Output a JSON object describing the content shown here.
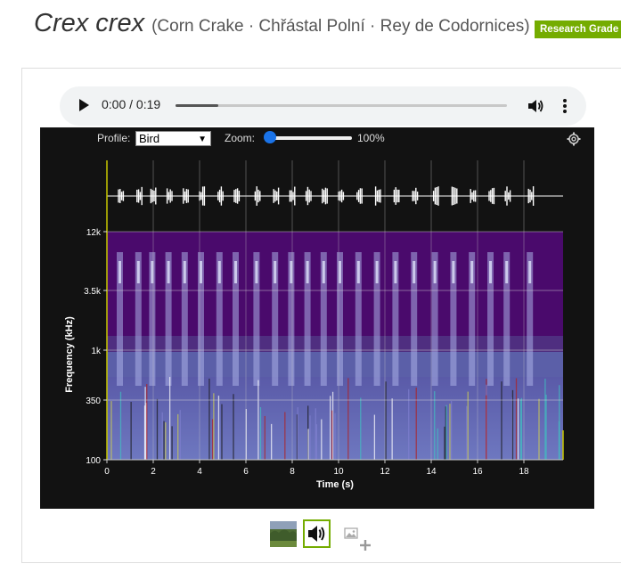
{
  "header": {
    "scientific_name": "Crex crex",
    "common_names": "(Corn Crake · Chřástal Polní · Rey de Codornices)",
    "grade_badge": "Research Grade"
  },
  "audio_player": {
    "time_display": "0:00 / 0:19",
    "progress_fraction": 0.13
  },
  "spectrogram": {
    "profile_label": "Profile:",
    "profile_value": "Bird",
    "zoom_label": "Zoom:",
    "zoom_value": "100%",
    "y_axis_label": "Frequency (kHz)",
    "x_axis_label": "Time (s)",
    "y_ticks": [
      "12k",
      "3.5k",
      "1k",
      "350",
      "100"
    ],
    "x_ticks": [
      "0",
      "2",
      "4",
      "6",
      "8",
      "10",
      "12",
      "14",
      "16",
      "18"
    ]
  },
  "media_thumbnails": {
    "items": [
      "photo-thumbnail",
      "audio-thumbnail",
      "add-media"
    ]
  }
}
